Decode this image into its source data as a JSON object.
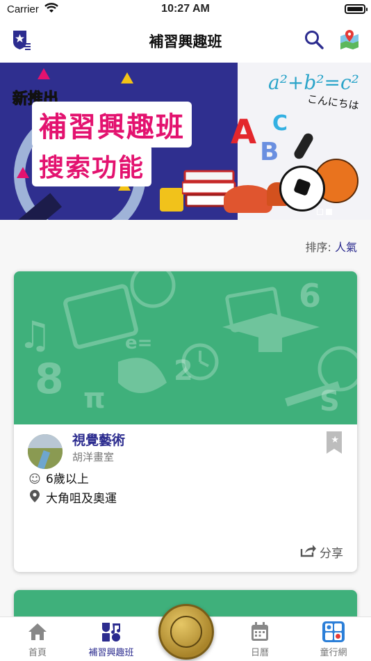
{
  "status_bar": {
    "carrier": "Carrier",
    "time": "10:27 AM"
  },
  "header": {
    "title": "補習興趣班",
    "icons": [
      "police-badge-icon",
      "search-icon",
      "map-pin-icon"
    ]
  },
  "banner": {
    "tag": "新推出",
    "line1": "補習興趣班",
    "line2": "搜索功能",
    "math": "a²+b²=c²",
    "greeting": "こんにちは",
    "letters": [
      "A",
      "B",
      "C"
    ],
    "page_count": 2,
    "active_page": 1
  },
  "sort": {
    "label": "排序:",
    "value": "人氣"
  },
  "course_card": {
    "title": "視覺藝術",
    "school": "胡洋畫室",
    "age": "6歲以上",
    "location": "大角咀及奧運",
    "share_label": "分享",
    "image_doodles": [
      "8",
      "6",
      "2",
      "e=",
      "π",
      "♫",
      "S"
    ]
  },
  "tabs": [
    {
      "label": "首頁",
      "icon": "home-icon",
      "active": false
    },
    {
      "label": "補習興趣班",
      "icon": "class-icon",
      "active": true
    },
    {
      "label": "日曆",
      "icon": "calendar-icon",
      "active": false
    },
    {
      "label": "童行網",
      "icon": "network-icon",
      "active": false
    }
  ],
  "colors": {
    "accent": "#2c2c8f",
    "banner_blue": "#2f2f8f",
    "banner_pink": "#e3126f",
    "card_green": "#3fb07b",
    "gold": "#c9a448"
  }
}
